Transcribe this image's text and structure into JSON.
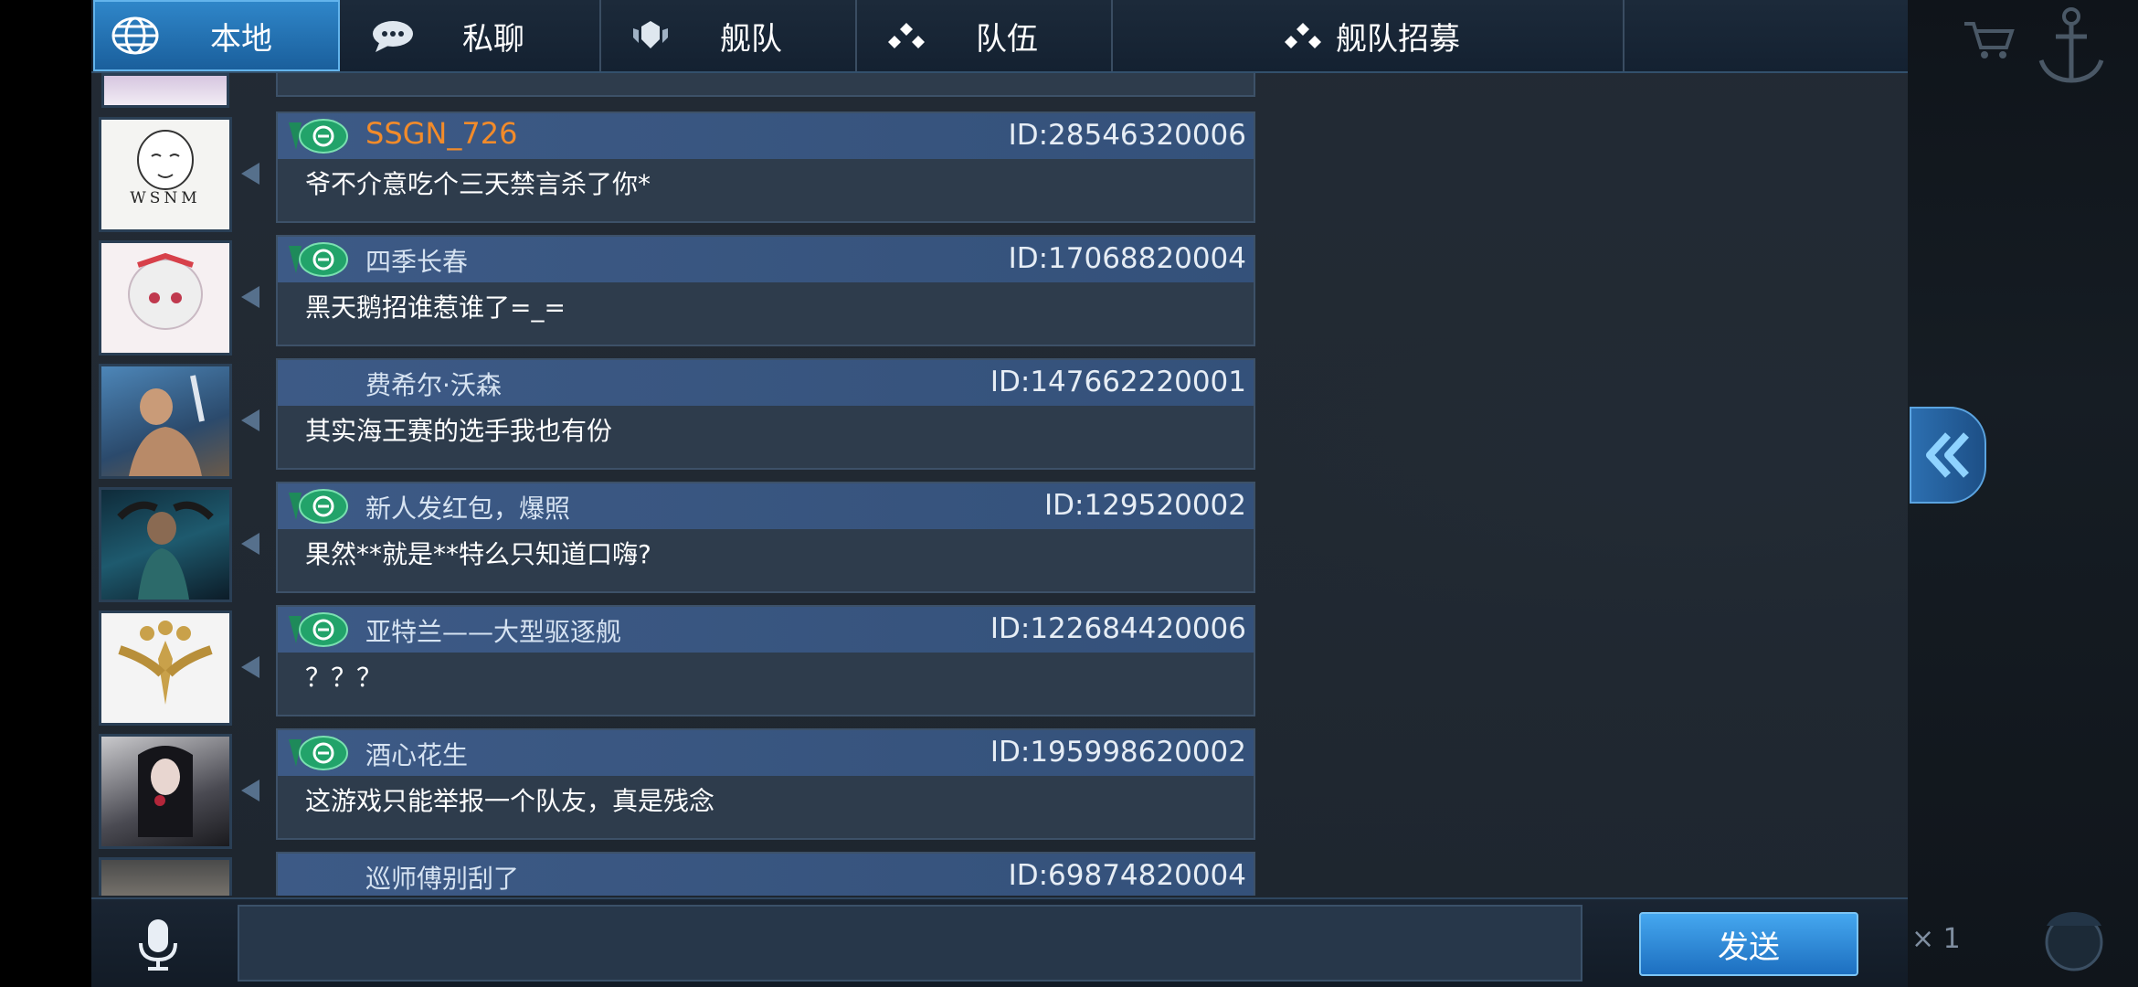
{
  "tabs": [
    {
      "label": "本地",
      "icon": "globe-icon",
      "active": true
    },
    {
      "label": "私聊",
      "icon": "speech-bubble-icon",
      "active": false
    },
    {
      "label": "舰队",
      "icon": "fleet-shield-icon",
      "active": false
    },
    {
      "label": "队伍",
      "icon": "team-dots-icon",
      "active": false
    },
    {
      "label": "舰队招募",
      "icon": "team-dots-icon",
      "active": false
    }
  ],
  "messages": [
    {
      "name": "SSGN_726",
      "id": "ID:28546320006",
      "text": "爷不介意吃个三天禁言杀了你*",
      "badge": true,
      "name_color": "orange",
      "avatar": "wsnm-meme-avatar",
      "avatar_caption": "WSNM"
    },
    {
      "name": "四季长春",
      "id": "ID:17068820004",
      "text": "黑天鹅招谁惹谁了=_=",
      "badge": true,
      "avatar": "anime-girl-avatar"
    },
    {
      "name": "费希尔·沃森",
      "id": "ID:147662220001",
      "text": "其实海王赛的选手我也有份",
      "badge": false,
      "avatar": "warrior-avatar"
    },
    {
      "name": "新人发红包，爆照",
      "id": "ID:129520002",
      "text": "果然**就是**特么只知道口嗨?",
      "badge": true,
      "avatar": "sea-king-avatar"
    },
    {
      "name": "亚特兰——大型驱逐舰",
      "id": "ID:122684420006",
      "text": "？？？",
      "badge": true,
      "avatar": "golden-dragon-avatar"
    },
    {
      "name": "酒心花生",
      "id": "ID:195998620002",
      "text": "这游戏只能举报一个队友，真是残念",
      "badge": true,
      "avatar": "dark-hair-girl-avatar"
    },
    {
      "name": "巡师傅别刮了",
      "id": "ID:69874820004",
      "text": "",
      "badge": false,
      "avatar": "portrait-avatar"
    }
  ],
  "input": {
    "value": "",
    "placeholder": ""
  },
  "send_label": "发送",
  "background": {
    "counter": "× 1"
  },
  "colors": {
    "accent": "#2f86c9",
    "name_orange": "#f28b2a",
    "header_blue": "#3d5a86"
  }
}
